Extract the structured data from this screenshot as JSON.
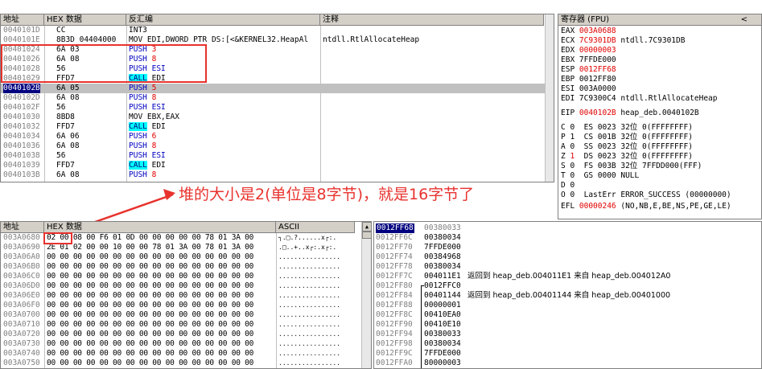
{
  "disasm": {
    "headers": {
      "address": "地址",
      "hex": "HEX 数据",
      "disasm": "反汇编",
      "comment": "注释"
    },
    "rows": [
      {
        "addr": "0040101D",
        "hex": "CC",
        "mnem": "INT3",
        "arg": "",
        "comment": "",
        "style": "plain"
      },
      {
        "addr": "0040101E",
        "hex": "8B3D 04404000",
        "mnem": "MOV EDI,DWORD PTR DS:[<&KERNEL32.HeapAl",
        "arg": "",
        "comment": "ntdll.RtlAllocateHeap",
        "style": "plain"
      },
      {
        "addr": "00401024",
        "hex": "6A 03",
        "mnem": "PUSH ",
        "arg": "3",
        "comment": "",
        "style": "push"
      },
      {
        "addr": "00401026",
        "hex": "6A 08",
        "mnem": "PUSH ",
        "arg": "8",
        "comment": "",
        "style": "push"
      },
      {
        "addr": "00401028",
        "hex": "56",
        "mnem": "PUSH ESI",
        "arg": "",
        "comment": "",
        "style": "push"
      },
      {
        "addr": "00401029",
        "hex": "FFD7",
        "mnem": "CALL",
        "arg": " EDI",
        "comment": "",
        "style": "call"
      },
      {
        "addr": "0040102B",
        "hex": "6A 05",
        "mnem": "PUSH ",
        "arg": "5",
        "comment": "",
        "style": "push"
      },
      {
        "addr": "0040102D",
        "hex": "6A 08",
        "mnem": "PUSH ",
        "arg": "8",
        "comment": "",
        "style": "push"
      },
      {
        "addr": "0040102F",
        "hex": "56",
        "mnem": "PUSH ESI",
        "arg": "",
        "comment": "",
        "style": "push"
      },
      {
        "addr": "00401030",
        "hex": "8BD8",
        "mnem": "MOV EBX,EAX",
        "arg": "",
        "comment": "",
        "style": "plain"
      },
      {
        "addr": "00401032",
        "hex": "FFD7",
        "mnem": "CALL",
        "arg": " EDI",
        "comment": "",
        "style": "call"
      },
      {
        "addr": "00401034",
        "hex": "6A 06",
        "mnem": "PUSH ",
        "arg": "6",
        "comment": "",
        "style": "push"
      },
      {
        "addr": "00401036",
        "hex": "6A 08",
        "mnem": "PUSH ",
        "arg": "8",
        "comment": "",
        "style": "push"
      },
      {
        "addr": "00401038",
        "hex": "56",
        "mnem": "PUSH ESI",
        "arg": "",
        "comment": "",
        "style": "push"
      },
      {
        "addr": "00401039",
        "hex": "FFD7",
        "mnem": "CALL",
        "arg": " EDI",
        "comment": "",
        "style": "call"
      },
      {
        "addr": "0040103B",
        "hex": "6A 08",
        "mnem": "PUSH ",
        "arg": "8",
        "comment": "",
        "style": "push"
      }
    ]
  },
  "registers": {
    "header": "寄存器 (FPU)",
    "collapse": "<",
    "lines": [
      {
        "name": "EAX",
        "value": "003A0688",
        "note": "",
        "red": true
      },
      {
        "name": "ECX",
        "value": "7C9301DB",
        "note": "ntdll.7C9301DB",
        "red": true
      },
      {
        "name": "EDX",
        "value": "00000003",
        "note": "",
        "red": true
      },
      {
        "name": "EBX",
        "value": "7FFDE000",
        "note": "",
        "red": false
      },
      {
        "name": "ESP",
        "value": "0012FF68",
        "note": "",
        "red": true
      },
      {
        "name": "EBP",
        "value": "0012FF80",
        "note": "",
        "red": false
      },
      {
        "name": "ESI",
        "value": "003A0000",
        "note": "",
        "red": false
      },
      {
        "name": "EDI",
        "value": "7C9300C4",
        "note": "ntdll.RtlAllocateHeap",
        "red": false
      }
    ],
    "eip": {
      "name": "EIP",
      "value": "0040102B",
      "note": "heap_deb.0040102B"
    },
    "flags": [
      "C 0  ES 0023 32位 0(FFFFFFFF)",
      "P 1  CS 001B 32位 0(FFFFFFFF)",
      "A 0  SS 0023 32位 0(FFFFFFFF)",
      "Z 1  DS 0023 32位 0(FFFFFFFF)",
      "S 0  FS 003B 32位 7FFDD000(FFF)",
      "T 0  GS 0000 NULL",
      "D 0"
    ],
    "lasterr": "O 0  LastErr ERROR_SUCCESS (00000000)",
    "efl": {
      "name": "EFL",
      "value": "00000246",
      "note": "(NO,NB,E,BE,NS,PE,GE,LE)"
    }
  },
  "annotation": "堆的大小是2(单位是8字节)，就是16字节了",
  "dump": {
    "headers": {
      "address": "地址",
      "hex": "HEX 数据",
      "ascii": "ASCII"
    },
    "rows": [
      {
        "addr": "003A0680",
        "hex": "02 00 08 00 F6 01 0D 00 00 00 00 00 78 01 3A 00",
        "ascii": "┐.□.?......x┌:."
      },
      {
        "addr": "003A0690",
        "hex": "2E 01 02 00 00 10 00 00 78 01 3A 00 78 01 3A 00",
        "ascii": ".□..+..x┌:.x┌:."
      },
      {
        "addr": "003A06A0",
        "hex": "00 00 00 00 00 00 00 00 00 00 00 00 00 00 00 00",
        "ascii": "................"
      },
      {
        "addr": "003A06B0",
        "hex": "00 00 00 00 00 00 00 00 00 00 00 00 00 00 00 00",
        "ascii": "................"
      },
      {
        "addr": "003A06C0",
        "hex": "00 00 00 00 00 00 00 00 00 00 00 00 00 00 00 00",
        "ascii": "................"
      },
      {
        "addr": "003A06D0",
        "hex": "00 00 00 00 00 00 00 00 00 00 00 00 00 00 00 00",
        "ascii": "................"
      },
      {
        "addr": "003A06E0",
        "hex": "00 00 00 00 00 00 00 00 00 00 00 00 00 00 00 00",
        "ascii": "................"
      },
      {
        "addr": "003A06F0",
        "hex": "00 00 00 00 00 00 00 00 00 00 00 00 00 00 00 00",
        "ascii": "................"
      },
      {
        "addr": "003A0700",
        "hex": "00 00 00 00 00 00 00 00 00 00 00 00 00 00 00 00",
        "ascii": "................"
      },
      {
        "addr": "003A0710",
        "hex": "00 00 00 00 00 00 00 00 00 00 00 00 00 00 00 00",
        "ascii": "................"
      },
      {
        "addr": "003A0720",
        "hex": "00 00 00 00 00 00 00 00 00 00 00 00 00 00 00 00",
        "ascii": "................"
      },
      {
        "addr": "003A0730",
        "hex": "00 00 00 00 00 00 00 00 00 00 00 00 00 00 00 00",
        "ascii": "................"
      },
      {
        "addr": "003A0740",
        "hex": "00 00 00 00 00 00 00 00 00 00 00 00 00 00 00 00",
        "ascii": "................"
      },
      {
        "addr": "003A0750",
        "hex": "00 00 00 00 00 00 00 00 00 00 00 00 00 00 00 00",
        "ascii": "................"
      }
    ]
  },
  "stack": {
    "rows": [
      {
        "addr": "0012FF68",
        "value": "00380033",
        "comment": ""
      },
      {
        "addr": "0012FF6C",
        "value": "00380034",
        "comment": ""
      },
      {
        "addr": "0012FF70",
        "value": "7FFDE000",
        "comment": ""
      },
      {
        "addr": "0012FF74",
        "value": "00384968",
        "comment": ""
      },
      {
        "addr": "0012FF78",
        "value": "00380034",
        "comment": ""
      },
      {
        "addr": "0012FF7C",
        "value": "004011E1",
        "comment": "返回到 heap_deb.004011E1 来自 heap_deb.004012A0"
      },
      {
        "addr": "0012FF80",
        "value": "0012FFC0",
        "comment": ""
      },
      {
        "addr": "0012FF84",
        "value": "00401144",
        "comment": "返回到 heap_deb.00401144 来自 heap_deb.00401000"
      },
      {
        "addr": "0012FF88",
        "value": "00000001",
        "comment": ""
      },
      {
        "addr": "0012FF8C",
        "value": "00410EA0",
        "comment": ""
      },
      {
        "addr": "0012FF90",
        "value": "00410E10",
        "comment": ""
      },
      {
        "addr": "0012FF94",
        "value": "00380033",
        "comment": ""
      },
      {
        "addr": "0012FF98",
        "value": "00380034",
        "comment": ""
      },
      {
        "addr": "0012FF9C",
        "value": "7FFDE000",
        "comment": ""
      },
      {
        "addr": "0012FFA0",
        "value": "80000003",
        "comment": ""
      },
      {
        "addr": "0012FFA4",
        "value": "004BDE14",
        "comment": ""
      }
    ]
  },
  "colors": {
    "red": "#e00000",
    "blue": "#0000c0",
    "cyan": "#00ffff",
    "selection": "#c0c0c0",
    "annotation": "#e8322e"
  }
}
